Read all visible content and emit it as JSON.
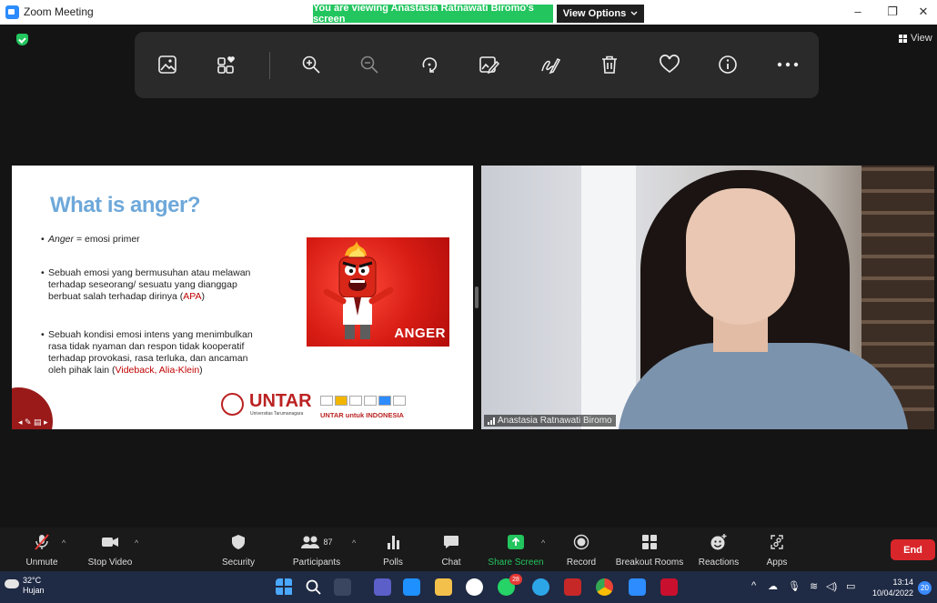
{
  "window": {
    "title": "Zoom Meeting",
    "viewing_banner": "You are viewing Anastasia Ratnawati Biromo's screen",
    "view_options": "View Options",
    "minimize": "–",
    "restore": "❐",
    "close": "✕"
  },
  "top_right": {
    "view_label": "View"
  },
  "annotation_toolbar": {
    "items": [
      "image-icon",
      "apps-icon",
      "zoom-in-icon",
      "zoom-out-icon",
      "rotate-icon",
      "edit-image-icon",
      "draw-icon",
      "trash-icon",
      "heart-icon",
      "info-icon",
      "more-icon"
    ]
  },
  "slide": {
    "title": "What is anger?",
    "bullets": [
      {
        "prefix": "Anger",
        "text": " = emosi primer"
      },
      {
        "line1": "Sebuah emosi yang bermusuhan atau melawan",
        "line2": "terhadap seseorang/ sesuatu yang dianggap",
        "line3_prefix": "berbuat salah terhadap dirinya (",
        "line3_red": "APA",
        "line3_suffix": ")"
      },
      {
        "line1": "Sebuah kondisi emosi intens yang menimbulkan",
        "line2": "rasa tidak nyaman dan respon tidak kooperatif",
        "line3": "terhadap provokasi, rasa terluka, dan ancaman",
        "line4_prefix": "oleh pihak lain (",
        "line4_red": "Videback, Alia-Klein",
        "line4_suffix": ")"
      }
    ],
    "image_label": "ANGER",
    "logo_text": "UNTAR",
    "logo_sub": "Universitas Tarumanagara",
    "tagline_prefix": "UNTAR untuk ",
    "tagline_bold": "INDONESIA"
  },
  "video": {
    "participant_name": "Anastasia Ratnawati Biromo"
  },
  "controls": {
    "unmute": "Unmute",
    "stop_video": "Stop Video",
    "security": "Security",
    "participants": "Participants",
    "participants_count": "87",
    "polls": "Polls",
    "chat": "Chat",
    "share_screen": "Share Screen",
    "record": "Record",
    "breakout_rooms": "Breakout Rooms",
    "reactions": "Reactions",
    "apps": "Apps",
    "end": "End"
  },
  "taskbar": {
    "temperature": "32°C",
    "weather": "Hujan",
    "time": "13:14",
    "date": "10/04/2022",
    "notifications": "20",
    "whatsapp_badge": "28"
  },
  "colors": {
    "accent_green": "#23c55e",
    "end_red": "#d9262b",
    "slide_title": "#6ea8da",
    "zoom_blue": "#2d8cff"
  }
}
